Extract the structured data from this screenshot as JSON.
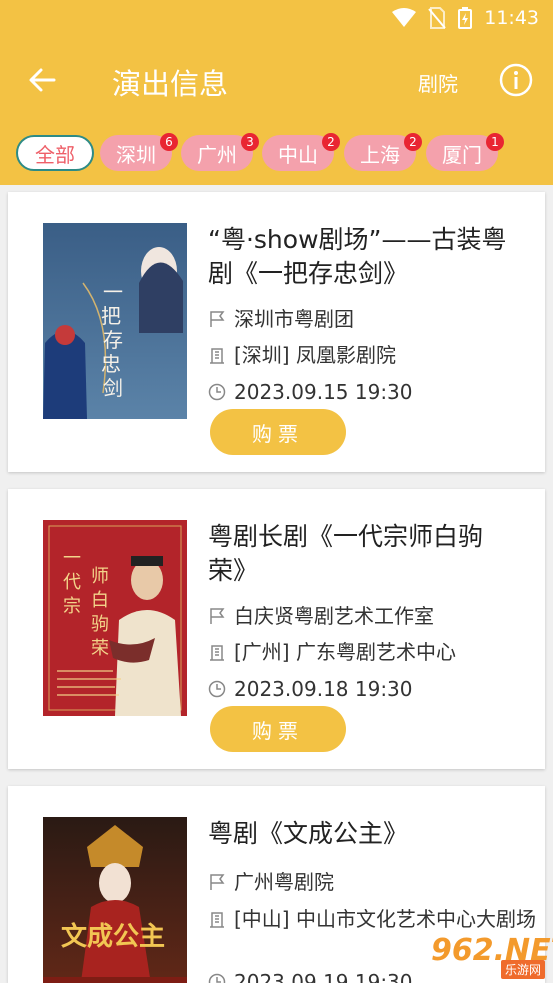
{
  "status_bar": {
    "time": "11:43"
  },
  "app_bar": {
    "title": "演出信息",
    "theater_link": "剧院"
  },
  "filters": [
    {
      "label": "全部",
      "count": null,
      "active": true
    },
    {
      "label": "深圳",
      "count": "6",
      "active": false
    },
    {
      "label": "广州",
      "count": "3",
      "active": false
    },
    {
      "label": "中山",
      "count": "2",
      "active": false
    },
    {
      "label": "上海",
      "count": "2",
      "active": false
    },
    {
      "label": "厦门",
      "count": "1",
      "active": false
    }
  ],
  "events": [
    {
      "title": "“粤·show剧场”——古装粤剧《一把存忠剑》",
      "troupe": "深圳市粤剧团",
      "venue": "[深圳] 凤凰影剧院",
      "datetime": "2023.09.15 19:30",
      "buy_label": "购票",
      "poster_text": "一把存忠剑"
    },
    {
      "title": "粤剧长剧《一代宗师白驹荣》",
      "troupe": "白庆贤粤剧艺术工作室",
      "venue": "[广州] 广东粤剧艺术中心",
      "datetime": "2023.09.18 19:30",
      "buy_label": "购票",
      "poster_text": "一代宗师白驹荣"
    },
    {
      "title": "粤剧《文成公主》",
      "troupe": "广州粤剧院",
      "venue": "[中山] 中山市文化艺术中心大剧场",
      "datetime": "2023.09.19 19:30",
      "buy_label": "购票",
      "poster_text": "文成公主"
    }
  ],
  "watermark": {
    "text": "962.NET",
    "sub": "乐游网"
  }
}
